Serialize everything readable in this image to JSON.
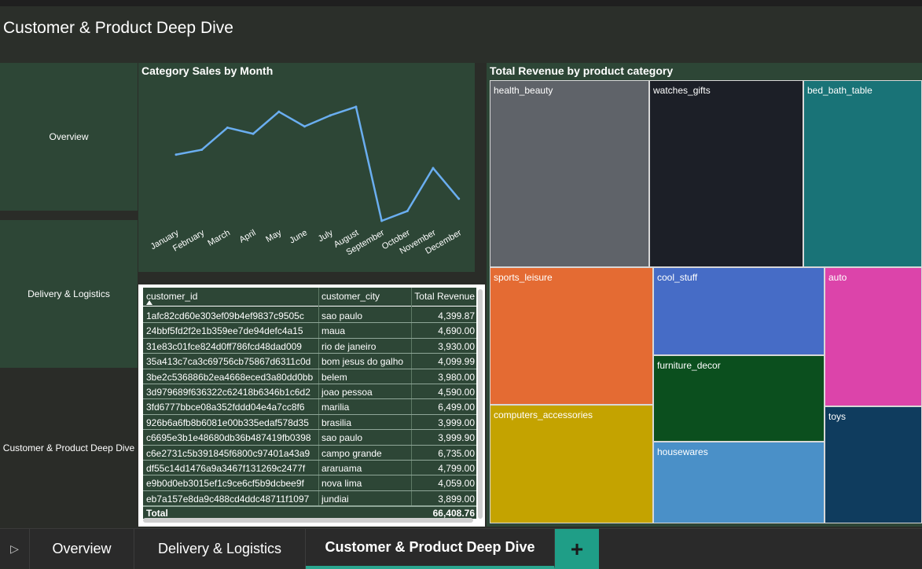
{
  "page_title": "Customer & Product Deep Dive",
  "nav": {
    "overview": "Overview",
    "delivery": "Delivery & Logistics",
    "customer": "Customer & Product Deep Dive"
  },
  "line_chart": {
    "title": "Category Sales by Month",
    "color": "#6aaef0"
  },
  "chart_data": [
    {
      "type": "line",
      "title": "Category Sales by Month",
      "categories": [
        "January",
        "February",
        "March",
        "April",
        "May",
        "June",
        "July",
        "August",
        "September",
        "October",
        "November",
        "December"
      ],
      "values": [
        0.54,
        0.58,
        0.76,
        0.71,
        0.89,
        0.77,
        0.86,
        0.93,
        0.0,
        0.08,
        0.43,
        0.18
      ],
      "grid": false,
      "xlabel": "",
      "ylabel": ""
    },
    {
      "type": "treemap",
      "title": "Total Revenue by product category",
      "categories": [
        "health_beauty",
        "watches_gifts",
        "bed_bath_table",
        "sports_leisure",
        "cool_stuff",
        "auto",
        "furniture_decor",
        "computers_accessories",
        "housewares",
        "toys"
      ]
    }
  ],
  "table": {
    "headers": {
      "id": "customer_id",
      "city": "customer_city",
      "revenue": "Total Revenue"
    },
    "rows": [
      {
        "id": "1afc82cd60e303ef09b4ef9837c9505c",
        "city": "sao paulo",
        "revenue": "4,399.87"
      },
      {
        "id": "24bbf5fd2f2e1b359ee7de94defc4a15",
        "city": "maua",
        "revenue": "4,690.00"
      },
      {
        "id": "31e83c01fce824d0ff786fcd48dad009",
        "city": "rio de janeiro",
        "revenue": "3,930.00"
      },
      {
        "id": "35a413c7ca3c69756cb75867d6311c0d",
        "city": "bom jesus do galho",
        "revenue": "4,099.99"
      },
      {
        "id": "3be2c536886b2ea4668eced3a80dd0bb",
        "city": "belem",
        "revenue": "3,980.00"
      },
      {
        "id": "3d979689f636322c62418b6346b1c6d2",
        "city": "joao pessoa",
        "revenue": "4,590.00"
      },
      {
        "id": "3fd6777bbce08a352fddd04e4a7cc8f6",
        "city": "marilia",
        "revenue": "6,499.00"
      },
      {
        "id": "926b6a6fb8b6081e00b335edaf578d35",
        "city": "brasilia",
        "revenue": "3,999.00"
      },
      {
        "id": "c6695e3b1e48680db36b487419fb0398",
        "city": "sao paulo",
        "revenue": "3,999.90"
      },
      {
        "id": "c6e2731c5b391845f6800c97401a43a9",
        "city": "campo grande",
        "revenue": "6,735.00"
      },
      {
        "id": "df55c14d1476a9a3467f131269c2477f",
        "city": "araruama",
        "revenue": "4,799.00"
      },
      {
        "id": "e9b0d0eb3015ef1c9ce6cf5b9dcbee9f",
        "city": "nova lima",
        "revenue": "4,059.00"
      },
      {
        "id": "eb7a157e8da9c488cd4ddc48711f1097",
        "city": "jundiai",
        "revenue": "3,899.00"
      }
    ],
    "total_label": "Total",
    "total_value": "66,408.76"
  },
  "treemap": {
    "title": "Total Revenue by product category",
    "tiles": [
      {
        "label": "health_beauty",
        "color": "#5f6369"
      },
      {
        "label": "watches_gifts",
        "color": "#1c1f27"
      },
      {
        "label": "bed_bath_table",
        "color": "#197377"
      },
      {
        "label": "sports_leisure",
        "color": "#e46b33"
      },
      {
        "label": "cool_stuff",
        "color": "#466cc6"
      },
      {
        "label": "auto",
        "color": "#dc44aa"
      },
      {
        "label": "furniture_decor",
        "color": "#0b4f1e"
      },
      {
        "label": "computers_accessories",
        "color": "#c4a300"
      },
      {
        "label": "housewares",
        "color": "#4a90c8"
      },
      {
        "label": "toys",
        "color": "#0f3c5e"
      }
    ]
  },
  "tabs": {
    "overview": "Overview",
    "delivery": "Delivery & Logistics",
    "customer": "Customer & Product Deep Dive",
    "add": "+"
  }
}
